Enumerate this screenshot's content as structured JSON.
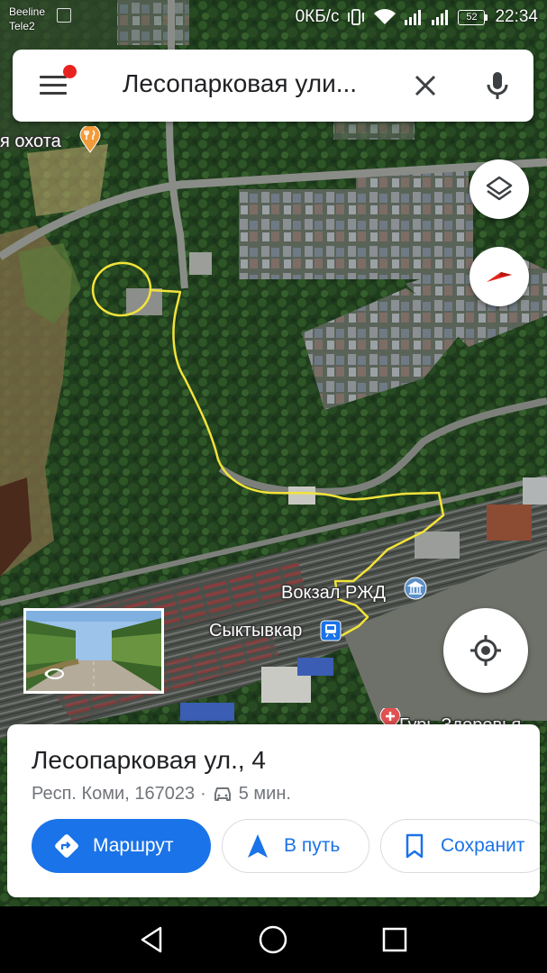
{
  "status_bar": {
    "carrier_1": "Beeline",
    "carrier_2": "Tele2",
    "data_speed": "0КБ/с",
    "battery": "52",
    "time": "22:34"
  },
  "search": {
    "query": "Лесопарковая ули..."
  },
  "map": {
    "labels": {
      "poi_hunt": "я охота",
      "station_poi": "Вокзал РЖД",
      "station_name": "Сыктывкар",
      "poi_cut": "Гурь Здоровья"
    },
    "icons": {
      "layers": "layers-icon",
      "compass": "compass-icon",
      "my_location": "my-location-icon",
      "restaurant": "restaurant-icon",
      "hospital": "hospital-icon",
      "landmark": "landmark-icon",
      "train": "train-icon"
    }
  },
  "place": {
    "title": "Лесопарковая ул., 4",
    "address": "Респ. Коми, 167023",
    "separator": "·",
    "drive_time": "5 мин."
  },
  "actions": {
    "route_label": "Маршрут",
    "start_label": "В путь",
    "save_label": "Сохранит"
  },
  "colors": {
    "accent": "#1a73e8",
    "notification_dot": "#e8231f",
    "drawn_path": "#f2e33a"
  }
}
